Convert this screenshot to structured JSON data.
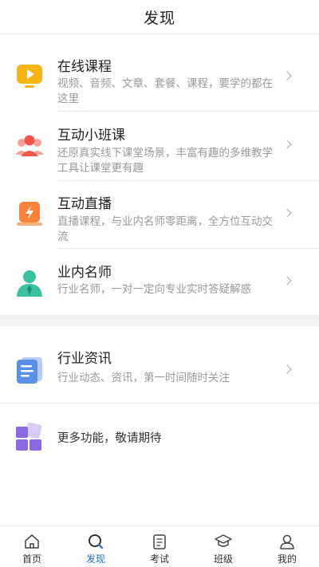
{
  "header": {
    "title": "发现"
  },
  "list": [
    {
      "title": "在线课程",
      "desc": "视频、音频、文章、套餐、课程，要学的都在这里"
    },
    {
      "title": "互动小班课",
      "desc": "还原真实线下课堂场景，丰富有趣的多维教学工具让课堂更有趣"
    },
    {
      "title": "互动直播",
      "desc": "直播课程，与业内名师零距离，全方位互动交流"
    },
    {
      "title": "业内名师",
      "desc": "行业名师，一对一定向专业实时答疑解惑"
    }
  ],
  "industry": {
    "title": "行业资讯",
    "desc": "行业动态、资讯，第一时间随时关注"
  },
  "more": {
    "label": "更多功能，敬请期待"
  },
  "tabs": [
    {
      "label": "首页"
    },
    {
      "label": "发现"
    },
    {
      "label": "考试"
    },
    {
      "label": "班级"
    },
    {
      "label": "我的"
    }
  ],
  "colors": {
    "accent": "#1f6fd6",
    "active_tab": "发现"
  }
}
